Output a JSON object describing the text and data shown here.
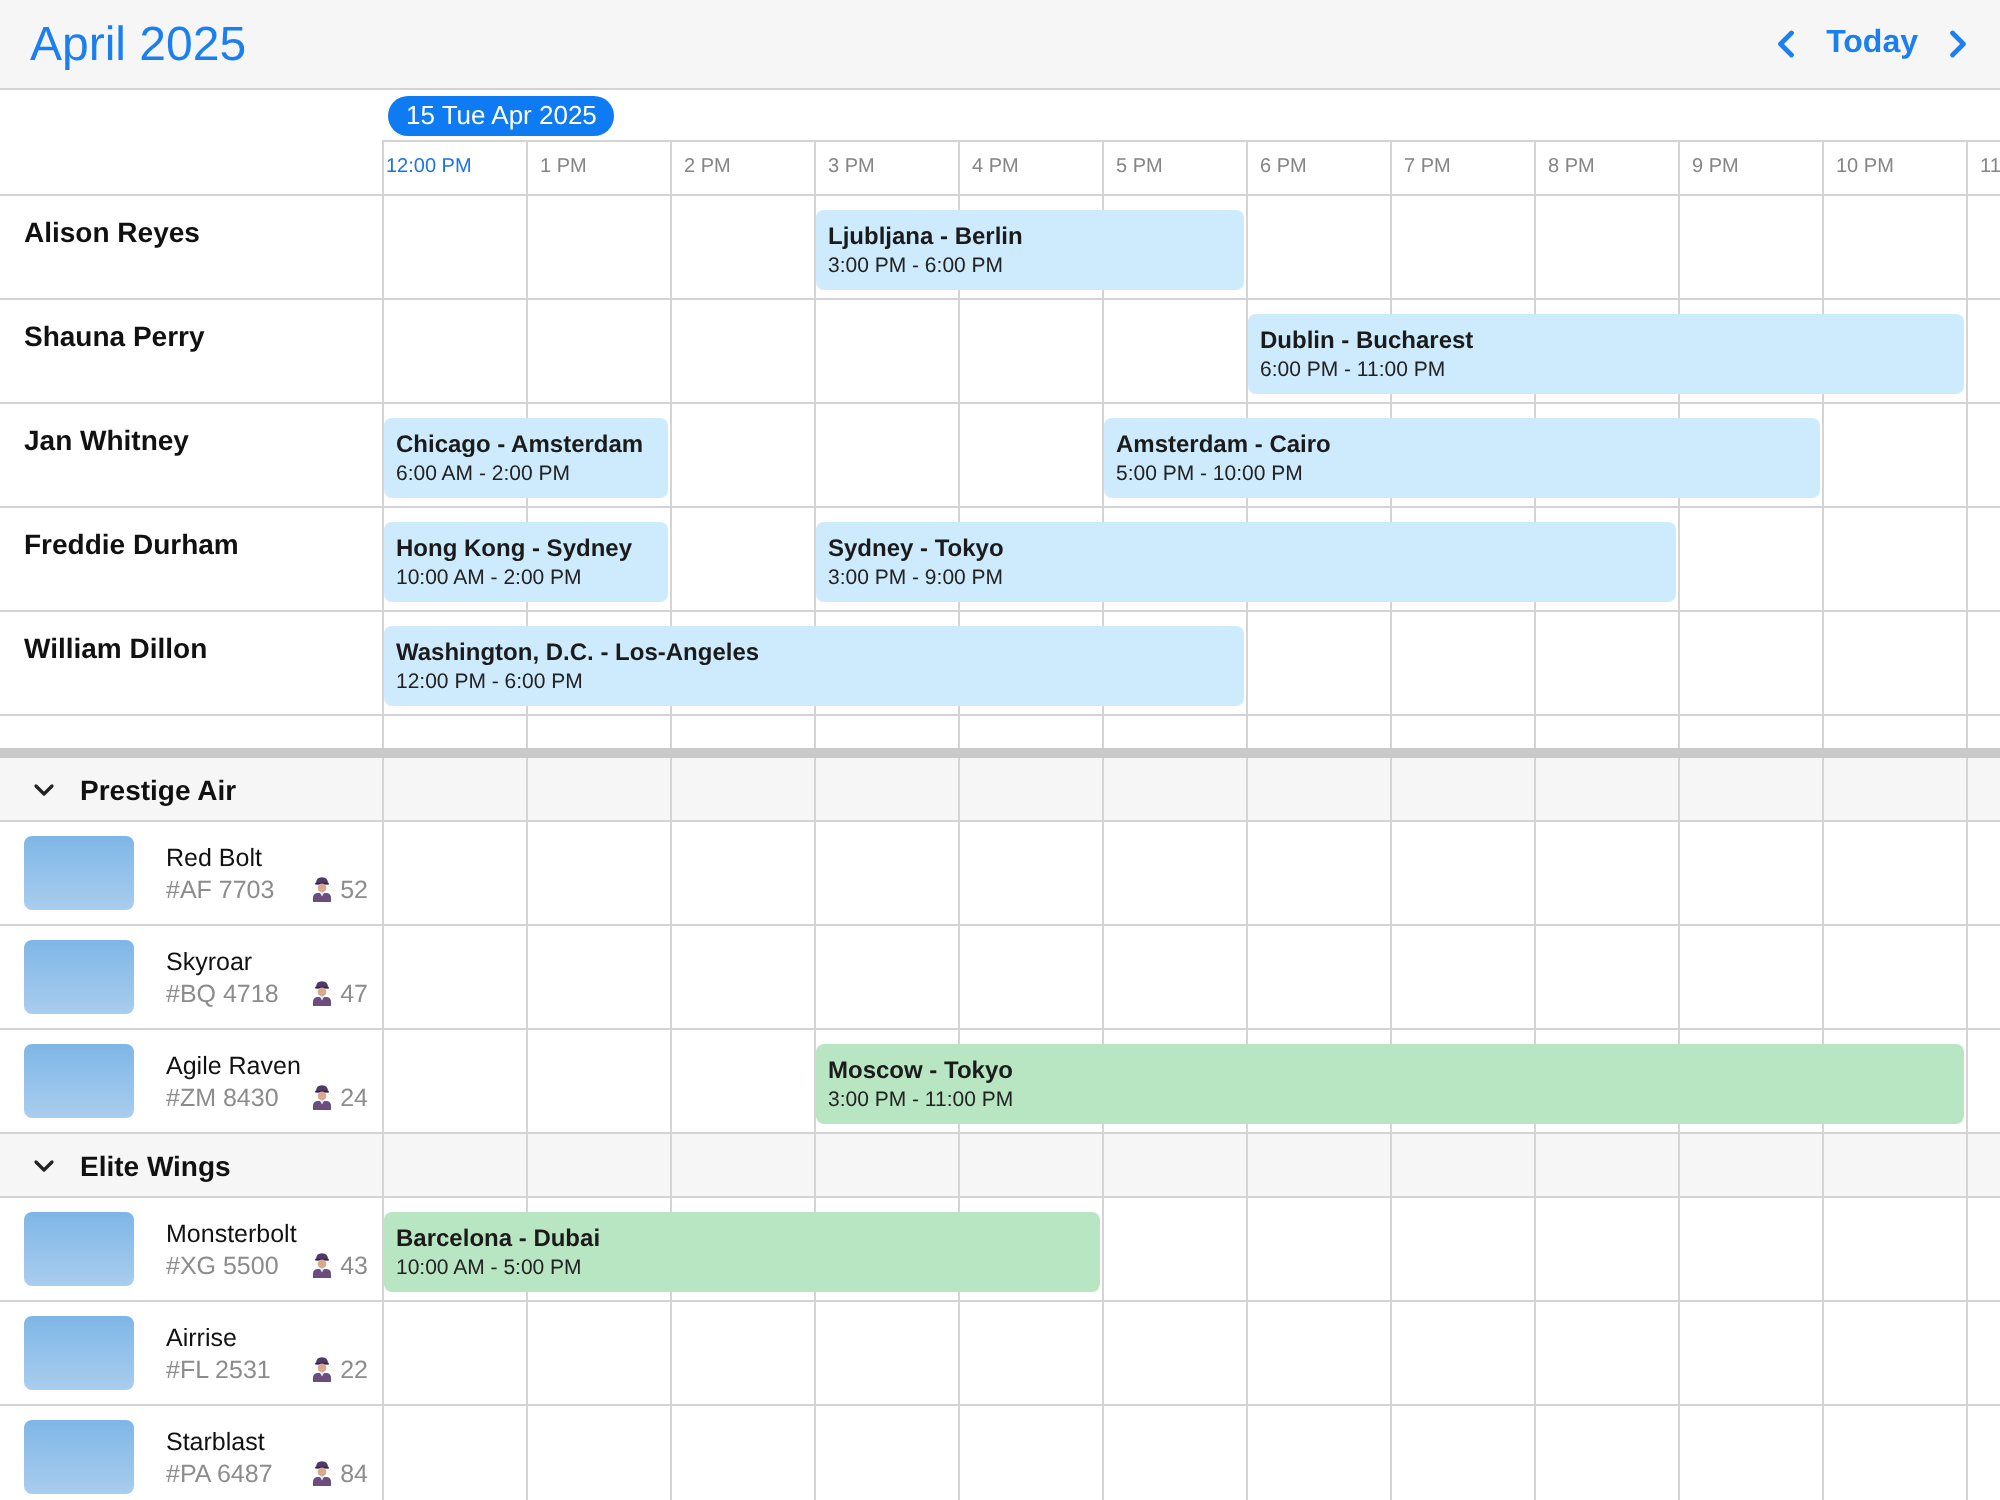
{
  "header": {
    "title": "April 2025",
    "today_label": "Today"
  },
  "timeline": {
    "date_badge": "15 Tue Apr 2025",
    "hours": [
      {
        "label": "12:00 PM",
        "current": true
      },
      {
        "label": "1 PM",
        "current": false
      },
      {
        "label": "2 PM",
        "current": false
      },
      {
        "label": "3 PM",
        "current": false
      },
      {
        "label": "4 PM",
        "current": false
      },
      {
        "label": "5 PM",
        "current": false
      },
      {
        "label": "6 PM",
        "current": false
      },
      {
        "label": "7 PM",
        "current": false
      },
      {
        "label": "8 PM",
        "current": false
      },
      {
        "label": "9 PM",
        "current": false
      },
      {
        "label": "10 PM",
        "current": false
      },
      {
        "label": "11",
        "current": false
      }
    ]
  },
  "crew": [
    {
      "name": "Alison Reyes",
      "flights": [
        {
          "route": "Ljubljana - Berlin",
          "time": "3:00 PM - 6:00 PM"
        }
      ]
    },
    {
      "name": "Shauna Perry",
      "flights": [
        {
          "route": "Dublin - Bucharest",
          "time": "6:00 PM - 11:00 PM"
        }
      ]
    },
    {
      "name": "Jan Whitney",
      "flights": [
        {
          "route": "Chicago - Amsterdam",
          "time": "6:00 AM - 2:00 PM"
        },
        {
          "route": "Amsterdam - Cairo",
          "time": "5:00 PM - 10:00 PM"
        }
      ]
    },
    {
      "name": "Freddie Durham",
      "flights": [
        {
          "route": "Hong Kong - Sydney",
          "time": "10:00 AM - 2:00 PM"
        },
        {
          "route": "Sydney - Tokyo",
          "time": "3:00 PM - 9:00 PM"
        }
      ]
    },
    {
      "name": "William Dillon",
      "flights": [
        {
          "route": "Washington, D.C. - Los-Angeles",
          "time": "12:00 PM - 6:00 PM"
        }
      ]
    }
  ],
  "fleet": [
    {
      "name": "Prestige Air",
      "expanded": true,
      "aircraft": [
        {
          "name": "Red Bolt",
          "code": "#AF 7703",
          "seats": "52"
        },
        {
          "name": "Skyroar",
          "code": "#BQ 4718",
          "seats": "47"
        },
        {
          "name": "Agile Raven",
          "code": "#ZM 8430",
          "seats": "24",
          "flights": [
            {
              "route": "Moscow - Tokyo",
              "time": "3:00 PM - 11:00 PM"
            }
          ]
        }
      ]
    },
    {
      "name": "Elite Wings",
      "expanded": true,
      "aircraft": [
        {
          "name": "Monsterbolt",
          "code": "#XG 5500",
          "seats": "43",
          "flights": [
            {
              "route": "Barcelona - Dubai",
              "time": "10:00 AM - 5:00 PM"
            }
          ]
        },
        {
          "name": "Airrise",
          "code": "#FL 2531",
          "seats": "22"
        },
        {
          "name": "Starblast",
          "code": "#PA 6487",
          "seats": "84"
        }
      ]
    }
  ]
}
